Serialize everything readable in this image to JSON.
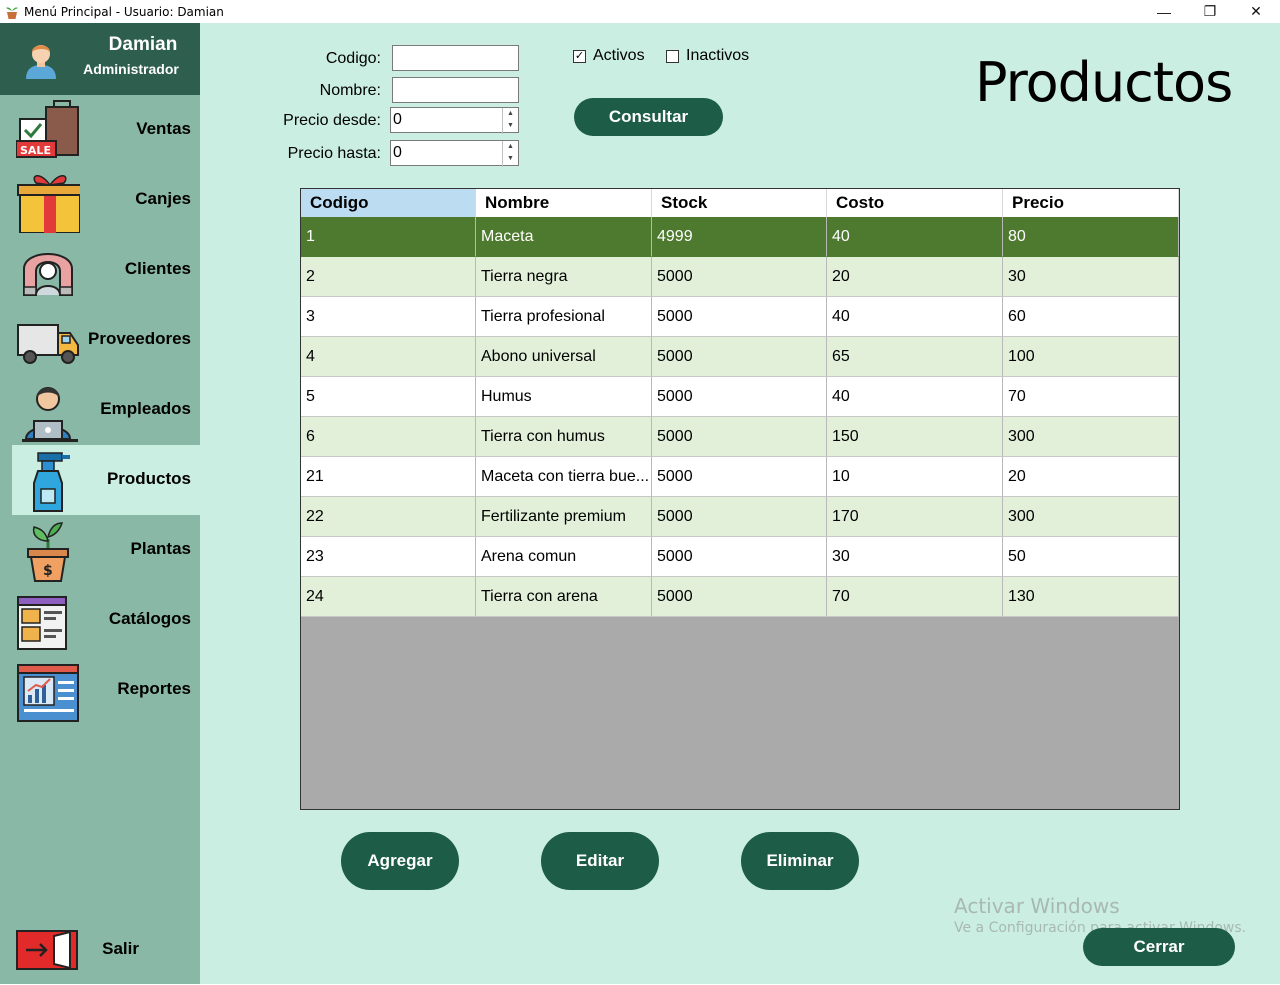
{
  "window": {
    "title": "Menú Principal - Usuario: Damian",
    "icon": "plant-pot-icon",
    "controls": {
      "minimize": "—",
      "maximize": "❐",
      "close": "✕"
    }
  },
  "user": {
    "name": "Damian",
    "role": "Administrador"
  },
  "sidebar": {
    "items": [
      {
        "label": "Ventas",
        "icon": "sale-bag-icon"
      },
      {
        "label": "Canjes",
        "icon": "gift-box-icon"
      },
      {
        "label": "Clientes",
        "icon": "customer-magnet-icon"
      },
      {
        "label": "Proveedores",
        "icon": "delivery-truck-icon"
      },
      {
        "label": "Empleados",
        "icon": "employee-laptop-icon"
      },
      {
        "label": "Productos",
        "icon": "spray-bottle-icon",
        "active": true
      },
      {
        "label": "Plantas",
        "icon": "money-plant-icon"
      },
      {
        "label": "Catálogos",
        "icon": "catalog-window-icon"
      },
      {
        "label": "Reportes",
        "icon": "report-chart-icon"
      }
    ],
    "exit": {
      "label": "Salir",
      "icon": "exit-door-icon"
    }
  },
  "filters": {
    "codigo_label": "Codigo:",
    "codigo_value": "",
    "nombre_label": "Nombre:",
    "nombre_value": "",
    "precio_desde_label": "Precio desde:",
    "precio_desde_value": "0",
    "precio_hasta_label": "Precio hasta:",
    "precio_hasta_value": "0",
    "activos_label": "Activos",
    "activos_checked": true,
    "inactivos_label": "Inactivos",
    "inactivos_checked": false,
    "consultar_label": "Consultar"
  },
  "page_title": "Productos",
  "table": {
    "columns": [
      "Codigo",
      "Nombre",
      "Stock",
      "Costo",
      "Precio"
    ],
    "rows": [
      [
        "1",
        "Maceta",
        "4999",
        "40",
        "80"
      ],
      [
        "2",
        "Tierra negra",
        "5000",
        "20",
        "30"
      ],
      [
        "3",
        "Tierra profesional",
        "5000",
        "40",
        "60"
      ],
      [
        "4",
        "Abono universal",
        "5000",
        "65",
        "100"
      ],
      [
        "5",
        "Humus",
        "5000",
        "40",
        "70"
      ],
      [
        "6",
        "Tierra con humus",
        "5000",
        "150",
        "300"
      ],
      [
        "21",
        "Maceta con tierra bue...",
        "5000",
        "10",
        "20"
      ],
      [
        "22",
        "Fertilizante premium",
        "5000",
        "170",
        "300"
      ],
      [
        "23",
        "Arena comun",
        "5000",
        "30",
        "50"
      ],
      [
        "24",
        "Tierra con arena",
        "5000",
        "70",
        "130"
      ]
    ],
    "selected_row": 0
  },
  "actions": {
    "agregar": "Agregar",
    "editar": "Editar",
    "eliminar": "Eliminar",
    "cerrar": "Cerrar"
  },
  "watermark": {
    "line1": "Activar Windows",
    "line2": "Ve a Configuración para activar Windows."
  },
  "colors": {
    "sidebar_bg": "#8ab8a6",
    "user_panel_bg": "#2e5e4d",
    "main_bg": "#cbeee3",
    "button_bg": "#1d5c47",
    "selected_row_bg": "#4e7a2f",
    "alt_row_bg": "#e2f0da"
  }
}
